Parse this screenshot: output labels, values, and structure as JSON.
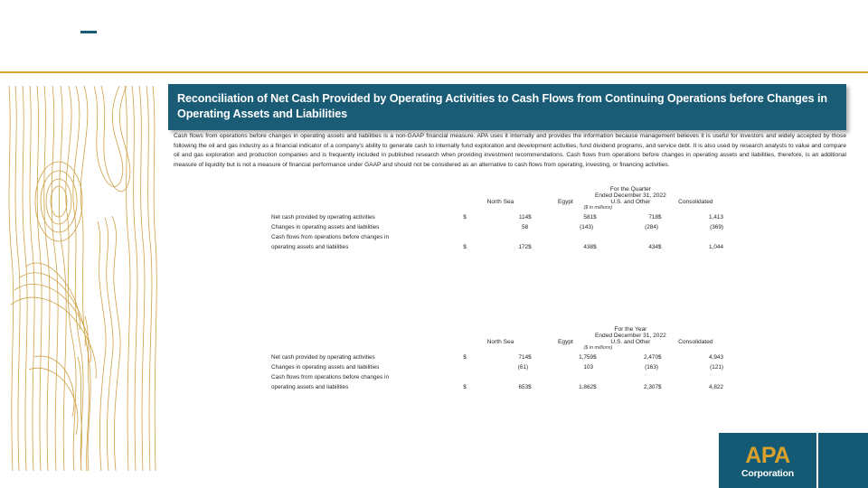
{
  "slide": {
    "title": "Reconciliation of Net Cash Provided by Operating Activities to Cash Flows from Continuing Operations before Changes in Operating Assets and Liabilities",
    "paragraph": "Cash flows from operations before changes in operating assets and liabilities is a non-GAAP financial measure. APA uses it internally and provides the information because management believes it is useful for investors and widely accepted by those following the oil and gas industry as a financial indicator of a company's ability to generate cash to internally fund exploration and development activities, fund dividend programs, and service debt. It is also used by research analysts to value and compare oil and gas exploration and production companies and is frequently included in published research when providing investment recommendations. Cash flows from operations before changes in operating assets and liabilities, therefore, is an additional measure of liquidity but is not a measure of financial performance under GAAP and should not be considered as an alternative to cash flows from operating, investing, or financing activities."
  },
  "colors": {
    "teal": "#1a5b76",
    "gold": "#d6a838",
    "logo_gold": "#d9a12c",
    "text": "#231f20"
  },
  "logo": {
    "name": "APA",
    "subtitle": "Corporation"
  },
  "tables": [
    {
      "id": "quarter",
      "period_title": "For the Quarter",
      "period_sub": "Ended December 31, 2022",
      "units": "($ in millions)",
      "columns": [
        "North Sea",
        "Egypt",
        "U.S. and Other",
        "Consolidated"
      ],
      "currency_symbol": "$",
      "rows": [
        {
          "label": "Net cash provided by operating activities",
          "label2": "",
          "show_currency": true,
          "values": [
            "114",
            "581",
            "718",
            "1,413"
          ]
        },
        {
          "label": "Changes in operating assets and liabilities",
          "label2": "",
          "show_currency": false,
          "values": [
            "58",
            "(143)",
            "(284)",
            "(369)"
          ]
        },
        {
          "label": "Cash flows from operations before changes in",
          "label2": "operating assets and liabilities",
          "show_currency": true,
          "values": [
            "172",
            "438",
            "434",
            "1,044"
          ]
        }
      ]
    },
    {
      "id": "year",
      "period_title": "For the Year",
      "period_sub": "Ended December 31, 2022",
      "units": "($ in millions)",
      "columns": [
        "North Sea",
        "Egypt",
        "U.S. and Other",
        "Consolidated"
      ],
      "currency_symbol": "$",
      "rows": [
        {
          "label": "Net cash provided by operating activities",
          "label2": "",
          "show_currency": true,
          "values": [
            "714",
            "1,759",
            "2,470",
            "4,943"
          ]
        },
        {
          "label": "Changes in operating assets and liabilities",
          "label2": "",
          "show_currency": false,
          "values": [
            "(61)",
            "103",
            "(163)",
            "(121)"
          ]
        },
        {
          "label": "Cash flows from operations before changes in",
          "label2": "operating assets and liabilities",
          "show_currency": true,
          "values": [
            "653",
            "1,862",
            "2,307",
            "4,822"
          ]
        }
      ]
    }
  ]
}
